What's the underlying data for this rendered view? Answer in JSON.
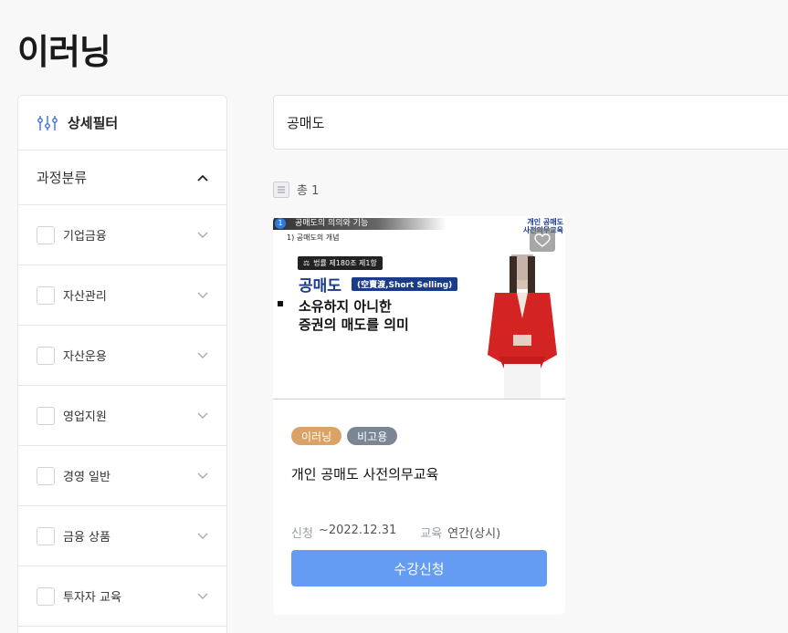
{
  "page": {
    "title": "이러닝"
  },
  "sidebar": {
    "header": "상세필터",
    "group": "과정분류",
    "items": [
      {
        "label": "기업금융"
      },
      {
        "label": "자산관리"
      },
      {
        "label": "자산운용"
      },
      {
        "label": "영업지원"
      },
      {
        "label": "경영 일반"
      },
      {
        "label": "금융 상품"
      },
      {
        "label": "투자자 교육"
      }
    ]
  },
  "search": {
    "value": "공매도"
  },
  "results": {
    "count_label": "총 1"
  },
  "card": {
    "thumbnail": {
      "banner_num": "1",
      "banner_text": "공매도의 의의와 기능",
      "sub": "1) 공매도의 개념",
      "corner_line1": "개인 공매도",
      "corner_line2": "사전의무교육",
      "law": "법률 제180조 제1항",
      "keyword": "공매도",
      "keyword_sub": "(空賣渡,Short Selling)",
      "desc1": "소유하지 아니한",
      "desc2": "증권의 매도를 의미"
    },
    "badges": [
      "이러닝",
      "비고용"
    ],
    "title": "개인 공매도 사전의무교육",
    "apply_key": "신청",
    "apply_value": "~2022.12.31",
    "edu_key": "교육",
    "edu_value": "연간(상시)",
    "button": "수강신청"
  },
  "colors": {
    "primary_button": "#649cf3",
    "badge_elearning": "#dba265",
    "badge_type": "#7b8695"
  }
}
